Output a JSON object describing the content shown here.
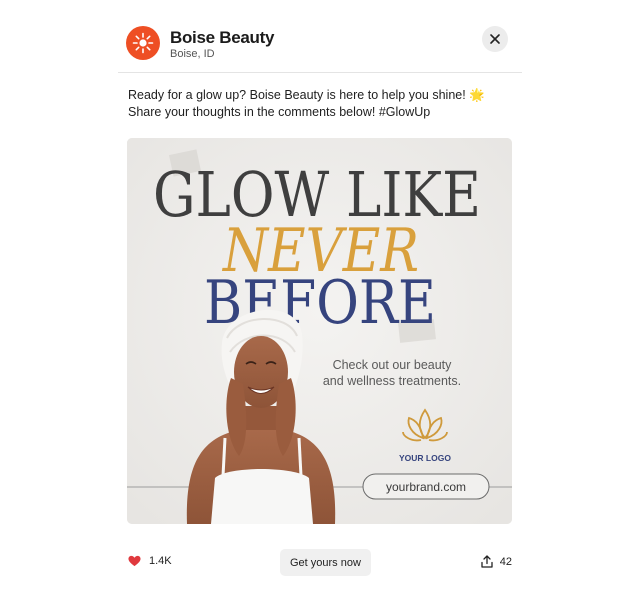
{
  "header": {
    "business_name": "Boise Beauty",
    "location": "Boise, ID",
    "avatar_icon": "sun-burst-icon",
    "close_icon": "close-icon"
  },
  "post": {
    "caption": "Ready for a glow up? Boise Beauty is here to help you shine! 🌟 Share your thoughts in the comments below! #GlowUp"
  },
  "promo": {
    "headline_line1": "GLOW LIKE",
    "headline_line2": "NEVER",
    "headline_line3": "BEFORE",
    "tagline_line1": "Check out our beauty",
    "tagline_line2": "and wellness treatments.",
    "logo_text": "YOUR LOGO",
    "website": "yourbrand.com",
    "logo_icon": "lotus-icon"
  },
  "footer": {
    "like_count": "1.4K",
    "cta_label": "Get yours now",
    "share_count": "42",
    "like_icon": "heart-icon",
    "share_icon": "share-icon"
  },
  "colors": {
    "brand_orange": "#ee4f24",
    "headline_gray": "#3f3f3f",
    "headline_gold": "#d9a03c",
    "headline_navy": "#36447e",
    "like_red": "#e0393e"
  }
}
